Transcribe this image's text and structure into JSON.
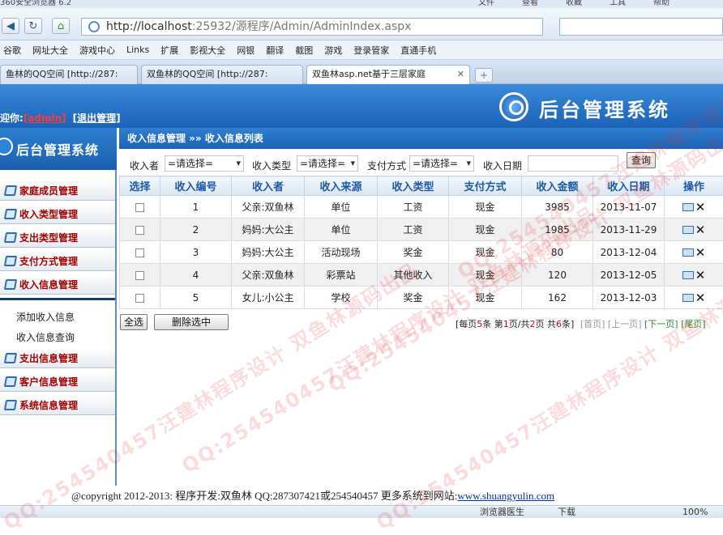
{
  "browser": {
    "title": "360安全浏览器 6.2",
    "menus": [
      "文件",
      "查看",
      "收藏",
      "工具",
      "帮助"
    ],
    "url_host": "http://localhost",
    "url_path": ":25932/源程序/Admin/AdminIndex.aspx",
    "favorites": [
      "谷歌",
      "网址大全",
      "游戏中心",
      "Links",
      "扩展",
      "影视大全",
      "网银",
      "翻译",
      "截图",
      "游戏",
      "登录管家",
      "直通手机"
    ],
    "tabs": [
      {
        "label": "鱼林的QQ空间 [http://287:"
      },
      {
        "label": "双鱼林的QQ空间 [http://287:"
      },
      {
        "label": "双鱼林asp.net基于三层家庭"
      }
    ],
    "status": {
      "doctor": "浏览器医生",
      "download": "下载",
      "zoom": "100%"
    }
  },
  "header": {
    "welcome": "迎你:",
    "user": "[admin]",
    "logout": "[退出管理]",
    "system_title": "后台管理系统"
  },
  "sidebar": {
    "title": "后台管理系统",
    "items": [
      {
        "label": "家庭成员管理"
      },
      {
        "label": "收入类型管理"
      },
      {
        "label": "支出类型管理"
      },
      {
        "label": "支付方式管理"
      },
      {
        "label": "收入信息管理"
      }
    ],
    "sub_items": [
      {
        "label": "添加收入信息"
      },
      {
        "label": "收入信息查询"
      }
    ],
    "items_bottom": [
      {
        "label": "支出信息管理"
      },
      {
        "label": "客户信息管理"
      },
      {
        "label": "系统信息管理"
      }
    ]
  },
  "main": {
    "breadcrumb": "收入信息管理 »» 收入信息列表",
    "filters": {
      "payer_label": "收入者",
      "payer_value": "=请选择=",
      "type_label": "收入类型",
      "type_value": "=请选择=",
      "paymethod_label": "支付方式",
      "paymethod_value": "=请选择=",
      "date_label": "收入日期",
      "query_button": "查询"
    },
    "table": {
      "headers": [
        "选择",
        "收入编号",
        "收入者",
        "收入来源",
        "收入类型",
        "支付方式",
        "收入金额",
        "收入日期",
        "操作"
      ],
      "rows": [
        {
          "id": "1",
          "payer": "父亲:双鱼林",
          "source": "单位",
          "type": "工资",
          "method": "现金",
          "amount": "3985",
          "date": "2013-11-07"
        },
        {
          "id": "2",
          "payer": "妈妈:大公主",
          "source": "单位",
          "type": "工资",
          "method": "现金",
          "amount": "1985",
          "date": "2013-11-29"
        },
        {
          "id": "3",
          "payer": "妈妈:大公主",
          "source": "活动现场",
          "type": "奖金",
          "method": "现金",
          "amount": "80",
          "date": "2013-12-04"
        },
        {
          "id": "4",
          "payer": "父亲:双鱼林",
          "source": "彩票站",
          "type": "其他收入",
          "method": "现金",
          "amount": "120",
          "date": "2013-12-05"
        },
        {
          "id": "5",
          "payer": "女儿:小公主",
          "source": "学校",
          "type": "奖金",
          "method": "现金",
          "amount": "162",
          "date": "2013-12-03"
        }
      ]
    },
    "select_all_button": "全选",
    "delete_selected_button": "删除选中",
    "pager": {
      "per_page_prefix": "[每页",
      "per_page": "5",
      "per_page_suffix": "条 第",
      "current": "1",
      "mid": "页/共",
      "total_pages": "2",
      "mid2": "页 共",
      "total_items": "6",
      "end": "条]",
      "first": "[首页]",
      "prev": "[上一页]",
      "next": "[下一页]",
      "last": "[尾页]"
    }
  },
  "footer": {
    "text": "@copyright 2012-2013: 程序开发:双鱼林  QQ:287307421或254540457  更多系统到网站:",
    "link": "www.shuangyulin.com"
  },
  "watermark": "QQ:254540457汪建林程序设计 双鱼林源码出品"
}
